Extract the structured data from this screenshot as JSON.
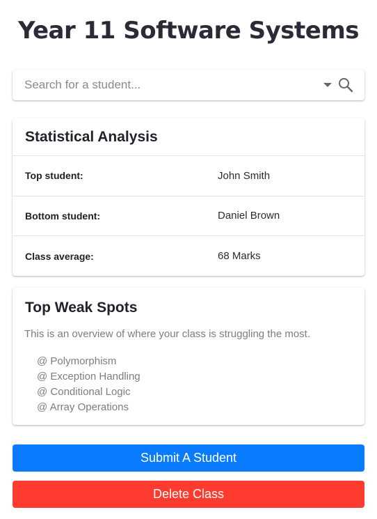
{
  "page": {
    "title": "Year 11 Software Systems"
  },
  "search": {
    "placeholder": "Search for a student...",
    "value": "",
    "dropdown_icon": "caret-down-icon",
    "search_icon": "search-icon"
  },
  "stats": {
    "title": "Statistical Analysis",
    "rows": [
      {
        "label": "Top student:",
        "value": "John Smith"
      },
      {
        "label": "Bottom student:",
        "value": "Daniel Brown"
      },
      {
        "label": "Class average:",
        "value": "68 Marks"
      }
    ]
  },
  "weak_spots": {
    "title": "Top Weak Spots",
    "description": "This is an overview of where your class is struggling the most.",
    "items": [
      "@ Polymorphism",
      "@ Exception Handling",
      "@ Conditional Logic",
      "@ Array Operations"
    ]
  },
  "actions": {
    "submit_label": "Submit A Student",
    "delete_label": "Delete Class"
  },
  "colors": {
    "submit": "#0a7afe",
    "delete": "#ff3b30",
    "title": "#2b2b38"
  }
}
